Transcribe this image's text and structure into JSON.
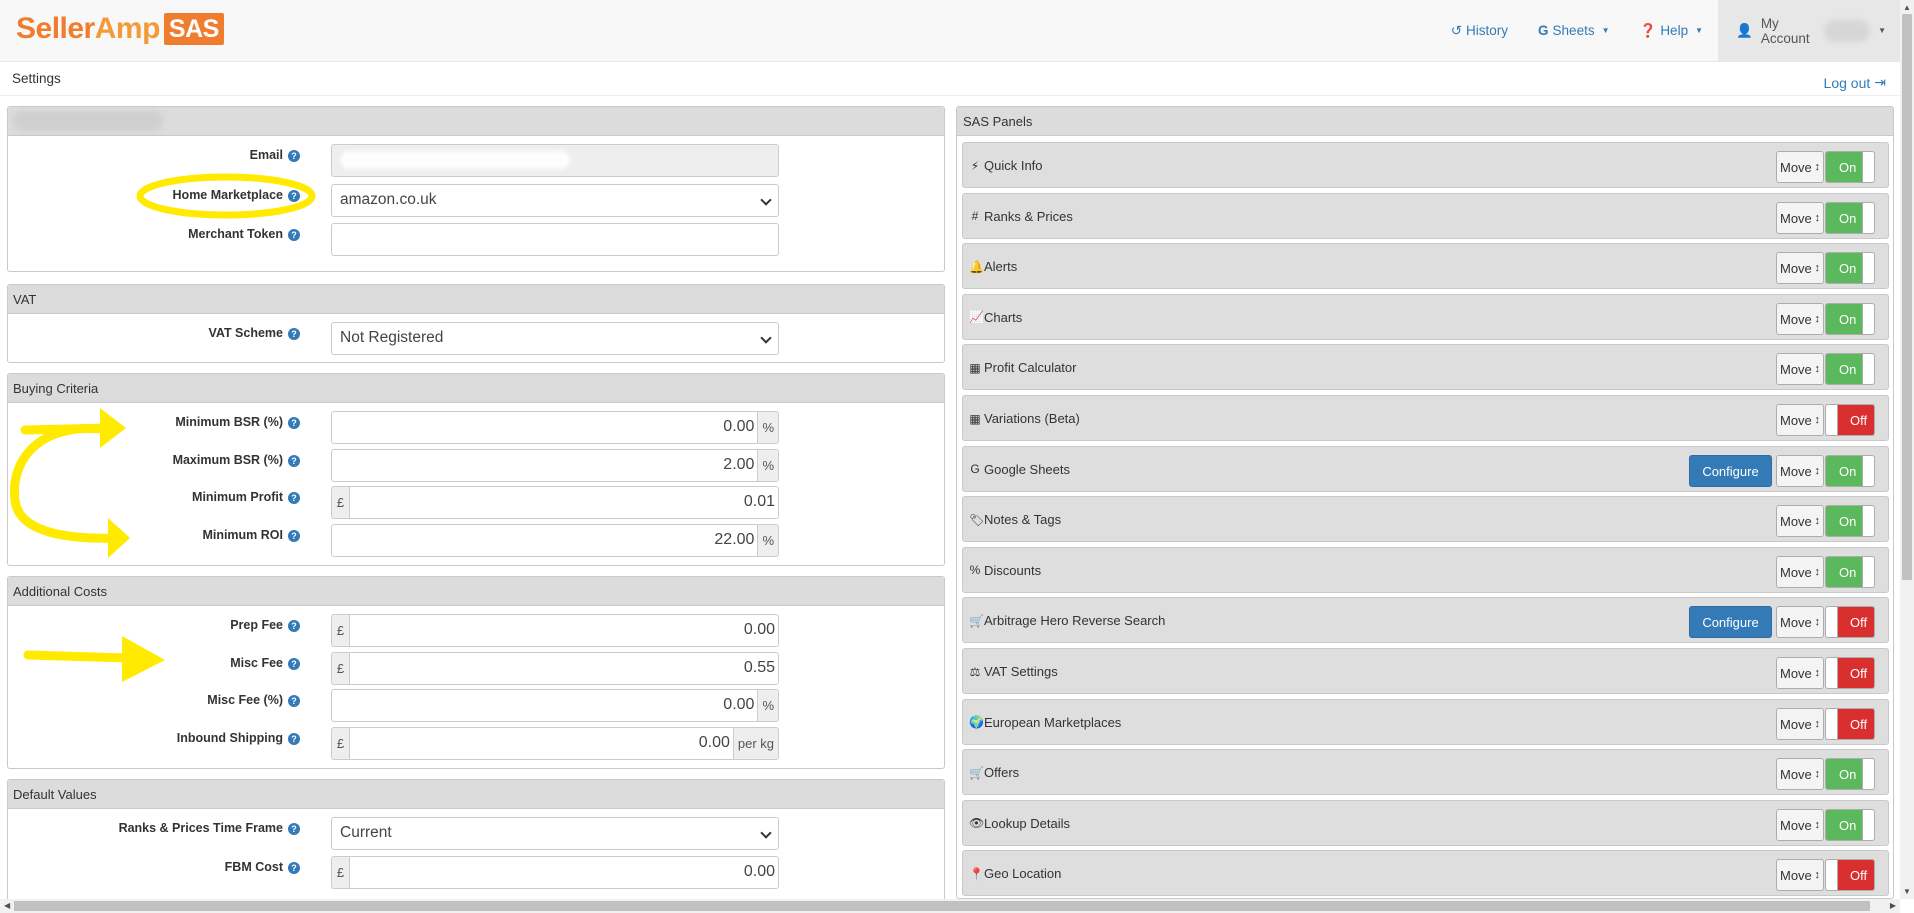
{
  "brand": {
    "part1": "Seller",
    "part2": "Amp",
    "part3": "SAS"
  },
  "nav": {
    "history": "History",
    "sheets": "Sheets",
    "help": "Help",
    "account": "My Account"
  },
  "page": {
    "title": "Settings",
    "logout": "Log out"
  },
  "account_panel": {
    "email_label": "Email",
    "marketplace_label": "Home Marketplace",
    "marketplace_value": "amazon.co.uk",
    "merchant_label": "Merchant Token",
    "merchant_value": ""
  },
  "vat_panel": {
    "title": "VAT",
    "scheme_label": "VAT Scheme",
    "scheme_value": "Not Registered"
  },
  "buying_panel": {
    "title": "Buying Criteria",
    "rows": [
      {
        "label": "Minimum BSR (%)",
        "value": "0.00",
        "suffix": "%"
      },
      {
        "label": "Maximum BSR (%)",
        "value": "2.00",
        "suffix": "%"
      },
      {
        "label": "Minimum Profit",
        "prefix": "£",
        "value": "0.01"
      },
      {
        "label": "Minimum ROI",
        "value": "22.00",
        "suffix": "%"
      }
    ]
  },
  "costs_panel": {
    "title": "Additional Costs",
    "rows": [
      {
        "label": "Prep Fee",
        "prefix": "£",
        "value": "0.00"
      },
      {
        "label": "Misc Fee",
        "prefix": "£",
        "value": "0.55"
      },
      {
        "label": "Misc Fee (%)",
        "value": "0.00",
        "suffix": "%"
      },
      {
        "label": "Inbound Shipping",
        "prefix": "£",
        "value": "0.00",
        "suffix": "per kg"
      }
    ]
  },
  "defaults_panel": {
    "title": "Default Values",
    "timeframe_label": "Ranks & Prices Time Frame",
    "timeframe_value": "Current",
    "fbm_label": "FBM Cost",
    "fbm_prefix": "£",
    "fbm_value": "0.00"
  },
  "sas_panels": {
    "title": "SAS Panels",
    "move_label": "Move",
    "configure_label": "Configure",
    "on_label": "On",
    "off_label": "Off",
    "items": [
      {
        "name": "Quick Info",
        "icon": "bolt-icon",
        "glyph": "⚡",
        "state": "on",
        "configure": false
      },
      {
        "name": "Ranks & Prices",
        "icon": "hash-icon",
        "glyph": "#",
        "state": "on",
        "configure": false
      },
      {
        "name": "Alerts",
        "icon": "bell-icon",
        "glyph": "🔔",
        "state": "on",
        "configure": false
      },
      {
        "name": "Charts",
        "icon": "line-chart-icon",
        "glyph": "📈",
        "state": "on",
        "configure": false
      },
      {
        "name": "Profit Calculator",
        "icon": "calculator-icon",
        "glyph": "▦",
        "state": "on",
        "configure": false
      },
      {
        "name": "Variations (Beta)",
        "icon": "grid-icon",
        "glyph": "▦",
        "state": "off",
        "configure": false
      },
      {
        "name": "Google Sheets",
        "icon": "google-icon",
        "glyph": "G",
        "state": "on",
        "configure": true
      },
      {
        "name": "Notes & Tags",
        "icon": "tag-icon",
        "glyph": "🏷",
        "state": "on",
        "configure": false
      },
      {
        "name": "Discounts",
        "icon": "percent-icon",
        "glyph": "%",
        "state": "on",
        "configure": false
      },
      {
        "name": "Arbitrage Hero Reverse Search",
        "icon": "cart-icon",
        "glyph": "🛒",
        "state": "off",
        "configure": true
      },
      {
        "name": "VAT Settings",
        "icon": "scale-icon",
        "glyph": "⚖",
        "state": "off",
        "configure": false
      },
      {
        "name": "European Marketplaces",
        "icon": "globe-icon",
        "glyph": "🌍",
        "state": "off",
        "configure": false
      },
      {
        "name": "Offers",
        "icon": "cart-icon",
        "glyph": "🛒",
        "state": "on",
        "configure": false
      },
      {
        "name": "Lookup Details",
        "icon": "eye-icon",
        "glyph": "👁",
        "state": "on",
        "configure": false
      },
      {
        "name": "Geo Location",
        "icon": "map-marker-icon",
        "glyph": "📍",
        "state": "off",
        "configure": false
      }
    ]
  }
}
